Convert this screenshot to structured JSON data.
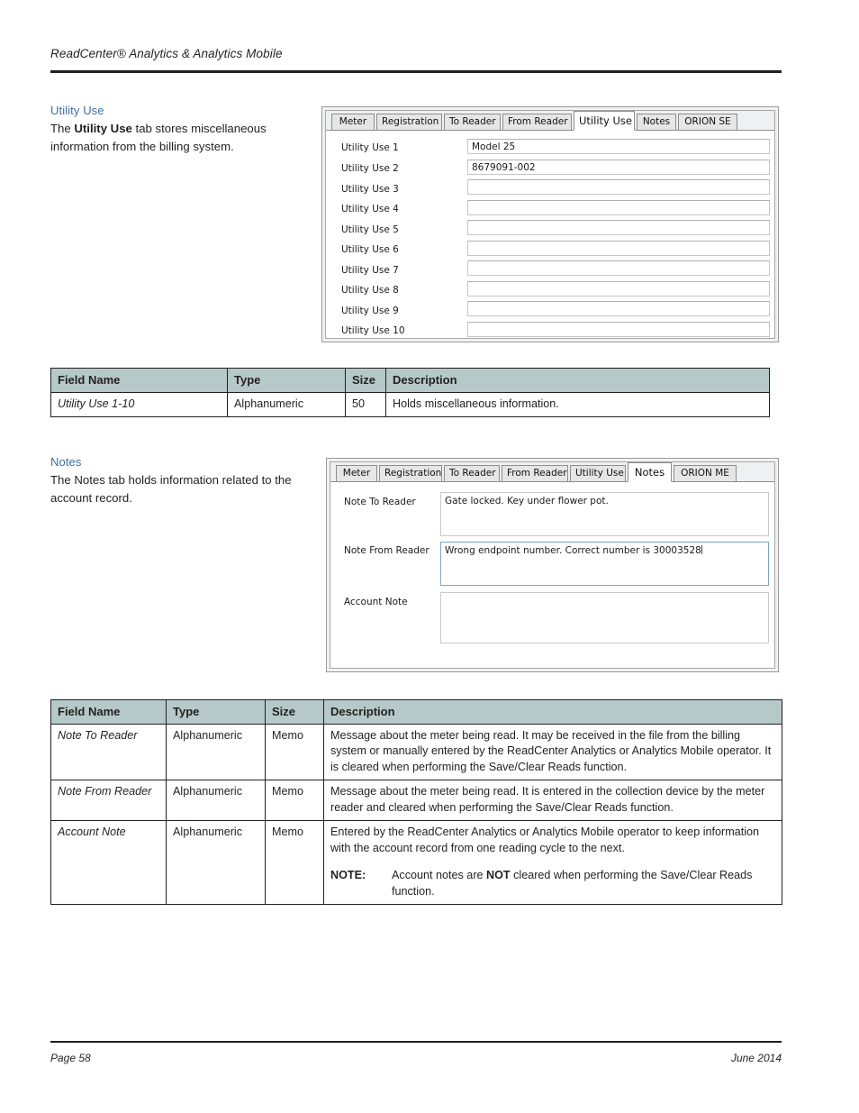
{
  "header": {
    "running_title": "ReadCenter® Analytics & Analytics Mobile"
  },
  "footer": {
    "page": "Page 58",
    "date": "June 2014"
  },
  "sections": [
    {
      "heading": "Utility Use",
      "body_prefix": "The ",
      "body_bold": "Utility Use",
      "body_suffix": " tab stores miscellaneous information from the billing system."
    },
    {
      "heading": "Notes",
      "body_full": "The Notes tab holds information related to the account record."
    }
  ],
  "utility_screenshot": {
    "tabs": [
      {
        "label": "Meter",
        "active": false
      },
      {
        "label": "Registration",
        "active": false
      },
      {
        "label": "To Reader",
        "active": false
      },
      {
        "label": "From Reader",
        "active": false
      },
      {
        "label": "Utility Use",
        "active": true
      },
      {
        "label": "Notes",
        "active": false
      },
      {
        "label": "ORION SE",
        "active": false
      }
    ],
    "fields": [
      {
        "label": "Utility Use 1",
        "value": "Model 25"
      },
      {
        "label": "Utility Use 2",
        "value": "8679091-002"
      },
      {
        "label": "Utility Use 3",
        "value": ""
      },
      {
        "label": "Utility Use 4",
        "value": ""
      },
      {
        "label": "Utility Use 5",
        "value": ""
      },
      {
        "label": "Utility Use 6",
        "value": ""
      },
      {
        "label": "Utility Use 7",
        "value": ""
      },
      {
        "label": "Utility Use 8",
        "value": ""
      },
      {
        "label": "Utility Use 9",
        "value": ""
      },
      {
        "label": "Utility Use 10",
        "value": ""
      }
    ]
  },
  "notes_screenshot": {
    "tabs": [
      {
        "label": "Meter",
        "active": false
      },
      {
        "label": "Registration",
        "active": false
      },
      {
        "label": "To Reader",
        "active": false
      },
      {
        "label": "From Reader",
        "active": false
      },
      {
        "label": "Utility Use",
        "active": false
      },
      {
        "label": "Notes",
        "active": true
      },
      {
        "label": "ORION ME",
        "active": false
      }
    ],
    "fields": [
      {
        "label": "Note To Reader",
        "value": "Gate locked.  Key under flower pot.",
        "focused": false
      },
      {
        "label": "Note From Reader",
        "value": "Wrong endpoint number. Correct number is 30003528",
        "focused": true
      },
      {
        "label": "Account Note",
        "value": "",
        "focused": false
      }
    ]
  },
  "table_utility": {
    "columns": [
      "Field Name",
      "Type",
      "Size",
      "Description"
    ],
    "rows": [
      {
        "field_name": "Utility Use 1-10",
        "type": "Alphanumeric",
        "size": "50",
        "description": "Holds miscellaneous information."
      }
    ]
  },
  "table_notes": {
    "columns": [
      "Field Name",
      "Type",
      "Size",
      "Description"
    ],
    "rows": [
      {
        "field_name": "Note To Reader",
        "type": "Alphanumeric",
        "size": "Memo",
        "description": "Message about the meter being read. It may be received in the file from the billing system or manually entered by the ReadCenter Analytics or Analytics Mobile operator. It is cleared when performing the Save/Clear Reads function."
      },
      {
        "field_name": "Note From Reader",
        "type": "Alphanumeric",
        "size": "Memo",
        "description": "Message about the meter being read. It is entered in the collection device by the meter reader and cleared when performing the Save/Clear Reads function."
      },
      {
        "field_name": "Account Note",
        "type": "Alphanumeric",
        "size": "Memo",
        "description": "Entered by the ReadCenter Analytics or Analytics Mobile operator to keep information with the account record from one reading cycle to the next.",
        "note_tag": "NOTE:",
        "note_prefix": "Account notes are ",
        "note_bold": "NOT",
        "note_suffix": " cleared when performing the Save/Clear Reads function."
      }
    ]
  },
  "colors": {
    "table_header_fill": "#b4c9c8",
    "heading_blue": "#3b6ea5",
    "body_text": "#231f20"
  }
}
